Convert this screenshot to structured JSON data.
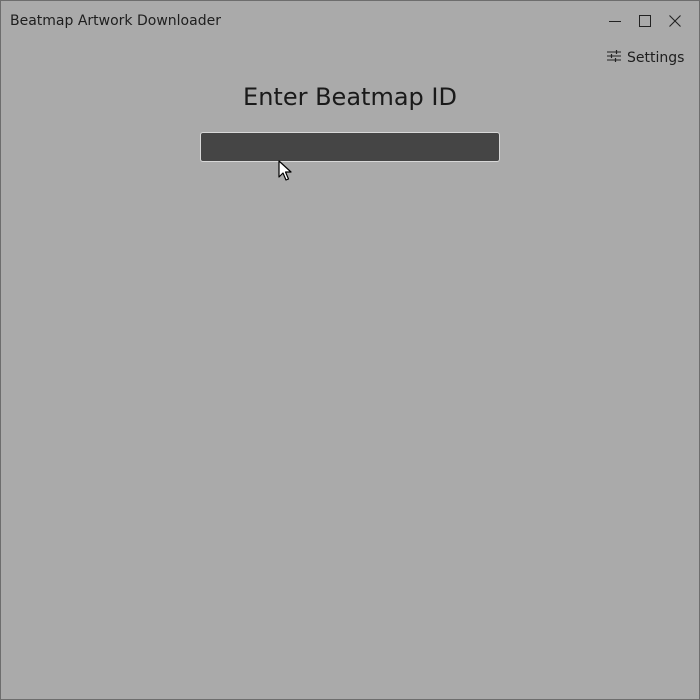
{
  "window": {
    "title": "Beatmap Artwork Downloader",
    "controls": {
      "minimize_icon": "minimize-icon",
      "maximize_icon": "maximize-icon",
      "close_icon": "close-icon"
    }
  },
  "toolbar": {
    "settings_label": "Settings",
    "settings_icon": "sliders-icon"
  },
  "main": {
    "heading": "Enter Beatmap ID",
    "beatmap_input": {
      "value": "",
      "placeholder": ""
    }
  },
  "colors": {
    "window_background": "#aaaaaa",
    "input_background": "#454545",
    "input_border": "#d8d8d8",
    "text": "#1e1e1e"
  }
}
